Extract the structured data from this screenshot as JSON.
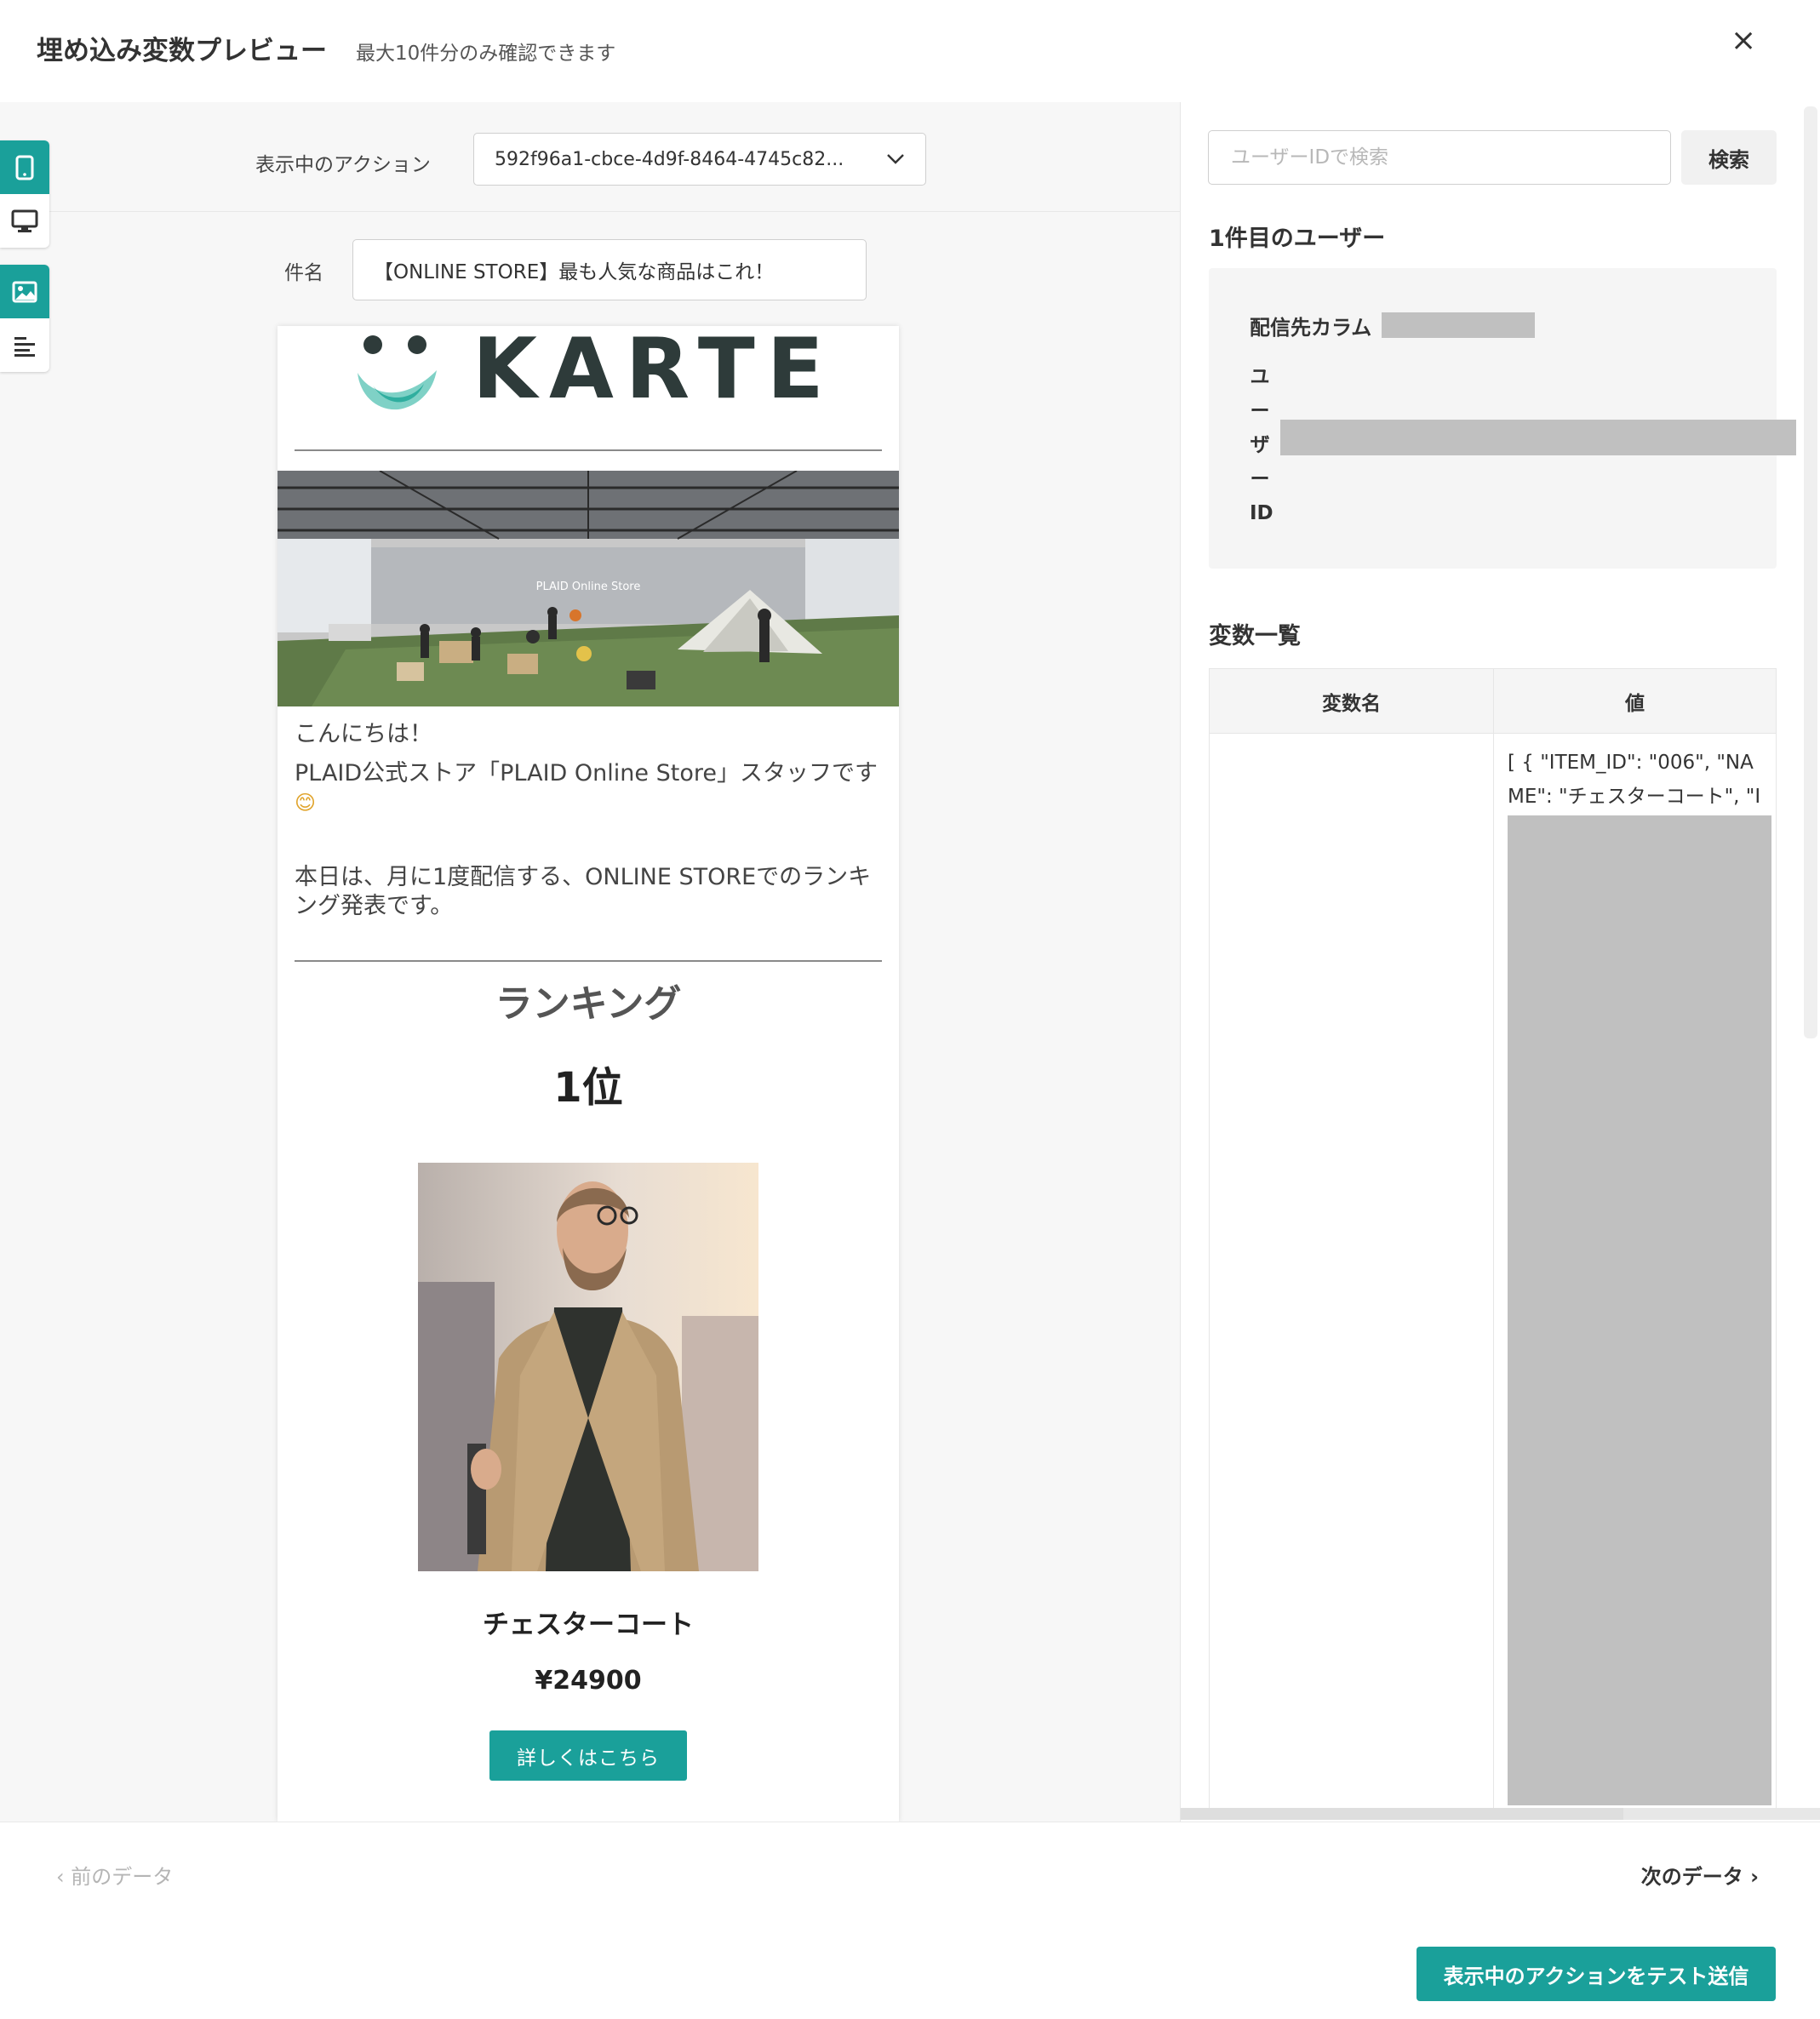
{
  "header": {
    "title": "埋め込み変数プレビュー",
    "subtitle": "最大10件分のみ確認できます",
    "close_label": "×"
  },
  "left_tools": {
    "device_group": [
      {
        "icon": "mobile-icon",
        "active": true
      },
      {
        "icon": "desktop-icon",
        "active": false
      }
    ],
    "view_group": [
      {
        "icon": "image-icon",
        "active": true
      },
      {
        "icon": "text-icon",
        "active": false
      }
    ]
  },
  "preview": {
    "action_label": "表示中のアクション",
    "action_value": "592f96a1-cbce-4d9f-8464-4745c82...",
    "subject_label": "件名",
    "subject_value": "【ONLINE STORE】最も人気な商品はこれ！",
    "email": {
      "logo_text": "KARTE",
      "banner_caption": "PLAID Online Store",
      "greeting_line1": "こんにちは！",
      "greeting_line2": "PLAID公式ストア「PLAID Online Store」スタッフです",
      "greeting_emoji": "😊",
      "body_text": "本日は、月に1度配信する、ONLINE STOREでのランキング発表です。",
      "ranking_title": "ランキング",
      "rank_label": "1位",
      "product_name": "チェスターコート",
      "product_price": "¥24900",
      "detail_button": "詳しくはこちら"
    }
  },
  "right_panel": {
    "search_placeholder": "ユーザーIDで検索",
    "search_button": "検索",
    "user_heading": "1件目のユーザー",
    "column_label": "配信先カラム",
    "user_id_label": "ユーザーID",
    "user_id_label_chars": [
      "ユ",
      "ー",
      "ザ",
      "ー",
      "ID"
    ],
    "vars_heading": "変数一覧",
    "table_headers": {
      "name": "変数名",
      "value": "値"
    },
    "value_preview": "[ { \"ITEM_ID\": \"006\", \"NAME\": \"チェスターコート\", \"IM"
  },
  "nav": {
    "prev_label": "前のデータ",
    "next_label": "次のデータ"
  },
  "footer": {
    "send_button": "表示中のアクションをテスト送信"
  },
  "colors": {
    "accent": "#1aa09a",
    "redaction": "#c0c0c0",
    "logo_teal": "#4fbfb0",
    "logo_dark": "#2e3b3a"
  }
}
